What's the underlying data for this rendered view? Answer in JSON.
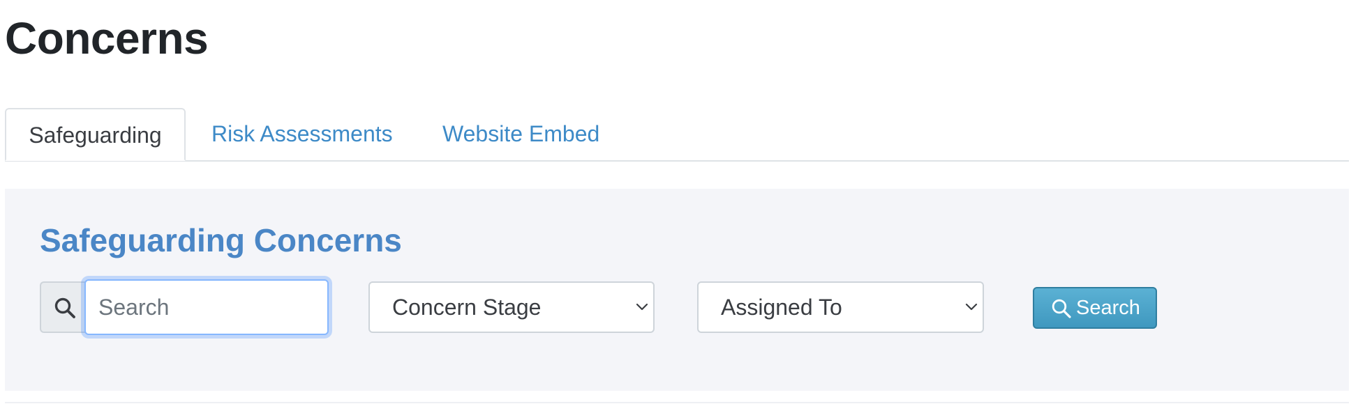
{
  "page": {
    "title": "Concerns"
  },
  "tabs": [
    {
      "label": "Safeguarding",
      "active": true
    },
    {
      "label": "Risk Assessments",
      "active": false
    },
    {
      "label": "Website Embed",
      "active": false
    }
  ],
  "panel": {
    "title": "Safeguarding Concerns",
    "search": {
      "placeholder": "Search",
      "value": "",
      "icon": "search-icon"
    },
    "filters": {
      "concern_stage": {
        "selected": "Concern Stage",
        "icon": "chevron-down-icon"
      },
      "assigned_to": {
        "selected": "Assigned To",
        "icon": "chevron-down-icon"
      }
    },
    "search_button": {
      "label": "Search",
      "icon": "search-icon"
    }
  },
  "colors": {
    "link": "#3d8ac7",
    "panel_title": "#4a86c6",
    "panel_background": "#f4f5f9",
    "button": "#4ea6cb"
  }
}
